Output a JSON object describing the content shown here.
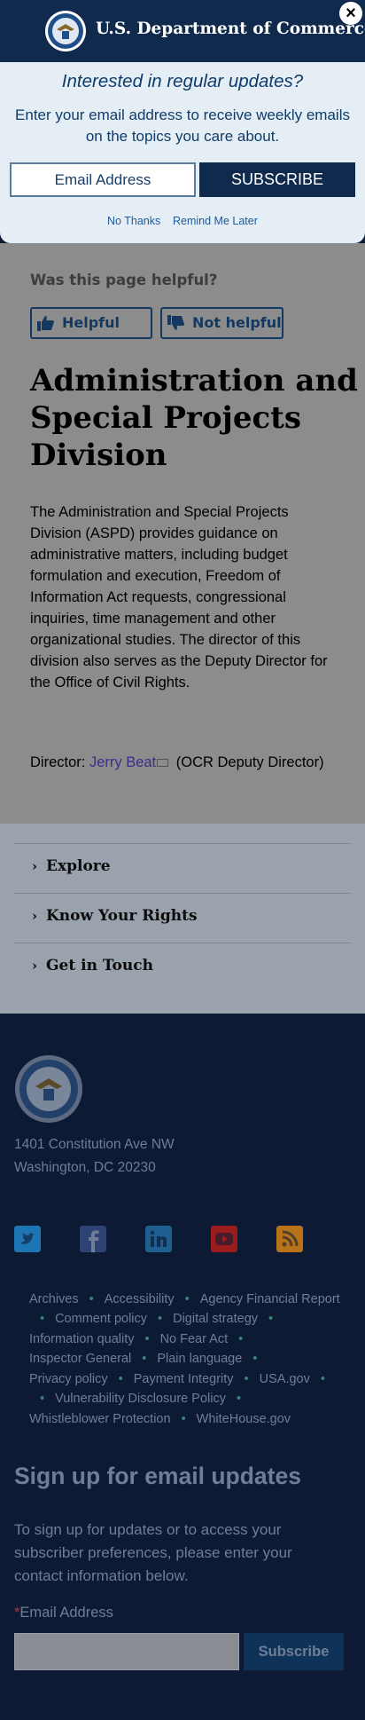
{
  "header": {
    "title": "U.S. Department of Commerce",
    "close_label": "×"
  },
  "modal": {
    "question": "Interested in regular updates?",
    "subtitle": "Enter your email address to receive weekly emails on the topics you care about.",
    "email_placeholder": "Email Address",
    "subscribe_label": "SUBSCRIBE",
    "no_thanks": "No Thanks",
    "remind_later": "Remind Me Later"
  },
  "feedback": {
    "question": "Was this page helpful?",
    "helpful": "Helpful",
    "not_helpful": "Not helpful"
  },
  "page": {
    "title": "Administration and Special Projects Division",
    "body": "The Administration and Special Projects Division (ASPD) provides guidance on administrative matters, including budget formulation and execution, Freedom of Information Act requests, congressional inquiries, time management and other organizational studies.  The director of this division also serves as the Deputy Director for the Office of Civil Rights.",
    "director_label": "Director: ",
    "director_name": "Jerry Beat",
    "director_role": "(OCR Deputy Director)"
  },
  "accordion": {
    "items": [
      "Explore",
      "Know Your Rights",
      "Get in Touch"
    ]
  },
  "footer": {
    "address_line1": "1401 Constitution Ave NW",
    "address_line2": "Washington, DC 20230",
    "social": [
      {
        "name": "twitter",
        "color": "#1d75b3"
      },
      {
        "name": "facebook",
        "color": "#2d4373"
      },
      {
        "name": "linkedin",
        "color": "#1f5f8f"
      },
      {
        "name": "youtube",
        "color": "#9b1c1c"
      },
      {
        "name": "rss",
        "color": "#b8731a"
      }
    ],
    "links": {
      "archives": "Archives",
      "accessibility": "Accessibility",
      "financial": "Agency Financial Report",
      "comment": "Comment policy",
      "digital": "Digital strategy",
      "infoquality": "Information quality",
      "nofear": "No Fear Act",
      "ig": "Inspector General",
      "plain": "Plain language",
      "privacy": "Privacy policy",
      "payment": "Payment Integrity",
      "usagov": "USA.gov",
      "vdp": "Vulnerability Disclosure Policy",
      "whistle": "Whistleblower Protection",
      "whitehouse": "WhiteHouse.gov"
    },
    "signup_heading": "Sign up for email updates",
    "signup_text": "To sign up for updates or to access your subscriber preferences, please enter your contact information below.",
    "email_label": "Email Address",
    "required_mark": "*",
    "subscribe_label": "Subscribe"
  }
}
